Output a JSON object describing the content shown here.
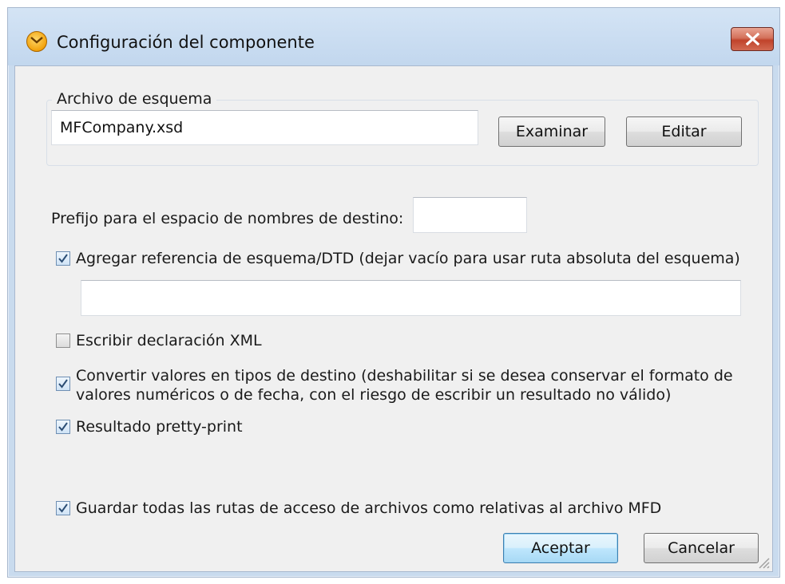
{
  "window": {
    "title": "Configuración del componente"
  },
  "schema_group": {
    "legend": "Archivo de esquema",
    "file_value": "MFCompany.xsd",
    "browse_label": "Examinar",
    "edit_label": "Editar"
  },
  "prefix": {
    "label": "Prefijo para el espacio de nombres de destino:",
    "value": ""
  },
  "options": {
    "add_reference": {
      "label": "Agregar referencia de esquema/DTD (dejar vacío para usar ruta absoluta del esquema)",
      "checked": true,
      "path_value": ""
    },
    "xml_declaration": {
      "label": "Escribir declaración XML",
      "checked": false
    },
    "convert_values": {
      "line1": "Convertir valores en tipos de destino (deshabilitar si se desea conservar el formato de",
      "line2": "valores numéricos o de fecha, con el riesgo de escribir un resultado no válido)",
      "checked": true
    },
    "pretty_print": {
      "label": "Resultado pretty-print",
      "checked": true
    },
    "relative_paths": {
      "label": "Guardar todas las rutas de acceso de archivos como relativas al archivo MFD",
      "checked": true
    }
  },
  "footer": {
    "ok_label": "Aceptar",
    "cancel_label": "Cancelar"
  }
}
